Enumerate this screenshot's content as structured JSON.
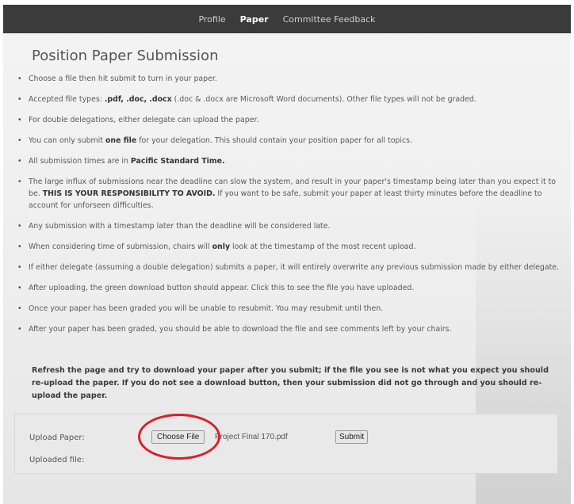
{
  "nav": {
    "items": [
      {
        "label": "Profile"
      },
      {
        "label": "Paper",
        "active": true
      },
      {
        "label": "Committee Feedback"
      }
    ]
  },
  "page": {
    "title": "Position Paper Submission"
  },
  "rules": [
    {
      "text": "Choose a file then hit submit to turn in your paper."
    },
    {
      "pre": "Accepted file types: ",
      "bold": ".pdf, .doc, .docx",
      "post": " (.doc & .docx are Microsoft Word documents). Other file types will not be graded."
    },
    {
      "text": "For double delegations, either delegate can upload the paper."
    },
    {
      "pre": "You can only submit ",
      "bold": "one file",
      "post": " for your delegation. This should contain your position paper for all topics."
    },
    {
      "pre": "All submission times are in ",
      "bold": "Pacific Standard Time.",
      "post": ""
    },
    {
      "pre": "The large influx of submissions near the deadline can slow the system, and result in your paper's timestamp being later than you expect it to be. ",
      "bold": "THIS IS YOUR RESPONSIBILITY TO AVOID.",
      "post": " If you want to be safe, submit your paper at least thirty minutes before the deadline to account for unforseen difficulties."
    },
    {
      "text": "Any submission with a timestamp later than the deadline will be considered late."
    },
    {
      "pre": "When considering time of submission, chairs will ",
      "bold": "only",
      "post": " look at the timestamp of the most recent upload."
    },
    {
      "text": "If either delegate (assuming a double delegation) submits a paper, it will entirely overwrite any previous submission made by either delegate."
    },
    {
      "text": "After uploading, the green download button should appear. Click this to see the file you have uploaded."
    },
    {
      "text": "Once your paper has been graded you will be unable to resubmit. You may resubmit until then."
    },
    {
      "text": "After your paper has been graded, you should be able to download the file and see comments left by your chairs."
    }
  ],
  "refresh_note": "Refresh the page and try to download your paper after you submit; if the file you see is not what you expect you should re-upload the paper. If you do not see a download button, then your submission did not go through and you should re-upload the paper.",
  "upload": {
    "upload_label": "Upload Paper:",
    "choose_file_label": "Choose File",
    "file_name": "Project Final 170.pdf",
    "submit_label": "Submit",
    "uploaded_label": "Uploaded file:"
  },
  "colors": {
    "navbar": "#3b3b3b",
    "highlight_circle": "#d8202a"
  }
}
